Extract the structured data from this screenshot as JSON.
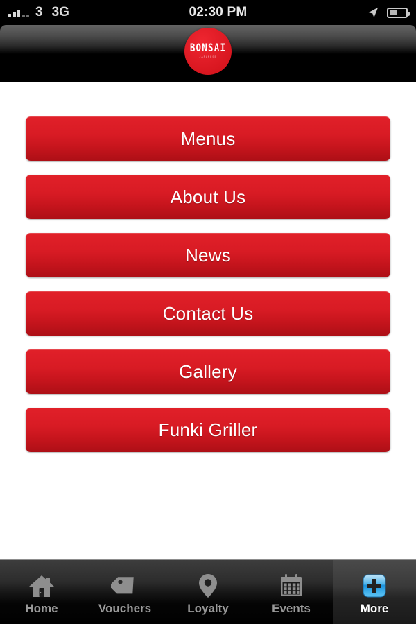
{
  "status_bar": {
    "signal_icon": "signal-bars-icon",
    "signal_bars_filled": 3,
    "signal_bars_empty": 2,
    "carrier": "3",
    "network": "3G",
    "time": "02:30 PM",
    "location_icon": "location-arrow-icon",
    "battery_icon": "battery-icon",
    "battery_percent": 50
  },
  "header": {
    "logo_name": "bonsai-logo",
    "logo_text": "BONSAI",
    "logo_subtext": "JAPANESE",
    "logo_color": "#d81b24"
  },
  "main": {
    "buttons": [
      {
        "label": "Menus",
        "name": "menu-button-menus"
      },
      {
        "label": "About Us",
        "name": "menu-button-about-us"
      },
      {
        "label": "News",
        "name": "menu-button-news"
      },
      {
        "label": "Contact Us",
        "name": "menu-button-contact-us"
      },
      {
        "label": "Gallery",
        "name": "menu-button-gallery"
      },
      {
        "label": "Funki Griller",
        "name": "menu-button-funki-griller"
      }
    ],
    "button_color_top": "#e12029",
    "button_color_bottom": "#ad0f16"
  },
  "tab_bar": {
    "tabs": [
      {
        "label": "Home",
        "icon": "house-icon",
        "active": false
      },
      {
        "label": "Vouchers",
        "icon": "tag-icon",
        "active": false
      },
      {
        "label": "Loyalty",
        "icon": "map-pin-icon",
        "active": false
      },
      {
        "label": "Events",
        "icon": "calendar-icon",
        "active": false
      },
      {
        "label": "More",
        "icon": "plus-square-icon",
        "active": true
      }
    ],
    "active_accent": "#2f9fe8"
  }
}
